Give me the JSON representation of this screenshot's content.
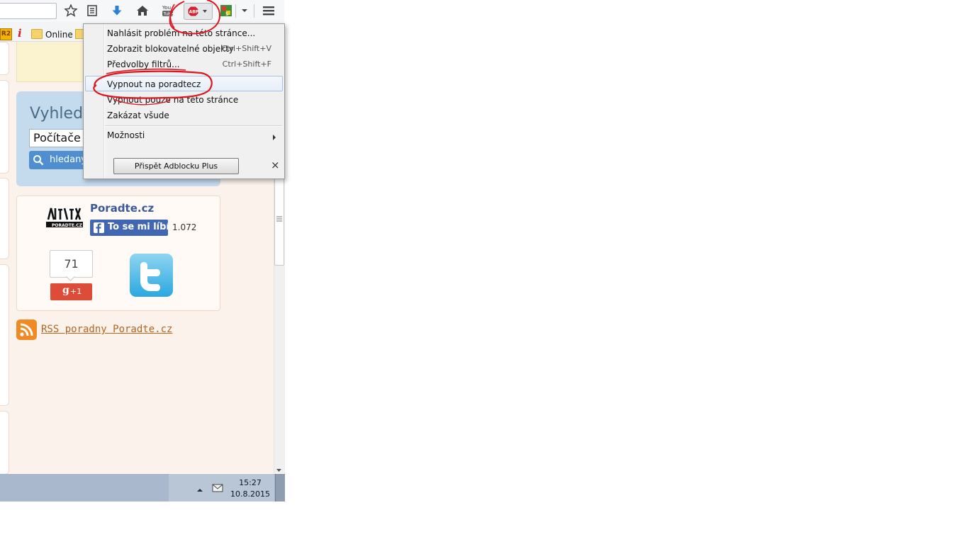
{
  "bookmarks": {
    "tag": "R2",
    "online_label": "Online"
  },
  "menu": {
    "items": [
      {
        "label": "Nahlásit problém na této stránce...",
        "shortcut": ""
      },
      {
        "label": "Zobrazit blokovatelné objekty",
        "shortcut": "Ctrl+Shift+V"
      },
      {
        "label": "Předvolby filtrů...",
        "shortcut": "Ctrl+Shift+F"
      },
      {
        "label": "Vypnout na poradtecz",
        "shortcut": ""
      },
      {
        "label": "Vypnout pouze na této stránce",
        "shortcut": ""
      },
      {
        "label": "Zakázat všude",
        "shortcut": ""
      },
      {
        "label": "Možnosti",
        "shortcut": ""
      }
    ],
    "contribute_label": "Přispět Adblocku Plus",
    "close_glyph": "×"
  },
  "search": {
    "title": "Vyhledá",
    "input_value": "Počítače a",
    "button_label": "hledany"
  },
  "social": {
    "site_name": "Poradte.cz",
    "like_label": "To se mi líbí",
    "like_count": "1.072",
    "gplus_count": "71",
    "gplus_label": "+1"
  },
  "rss": {
    "label": "RSS poradny Poradte.cz"
  },
  "taskbar": {
    "time": "15:27",
    "date": "10.8.2015"
  },
  "colors": {
    "abp_red": "#d4232e",
    "facebook": "#4267b2",
    "gplus": "#dd4b39",
    "rss": "#f08a24",
    "link": "#b5651d",
    "annotation": "#e0141e"
  }
}
